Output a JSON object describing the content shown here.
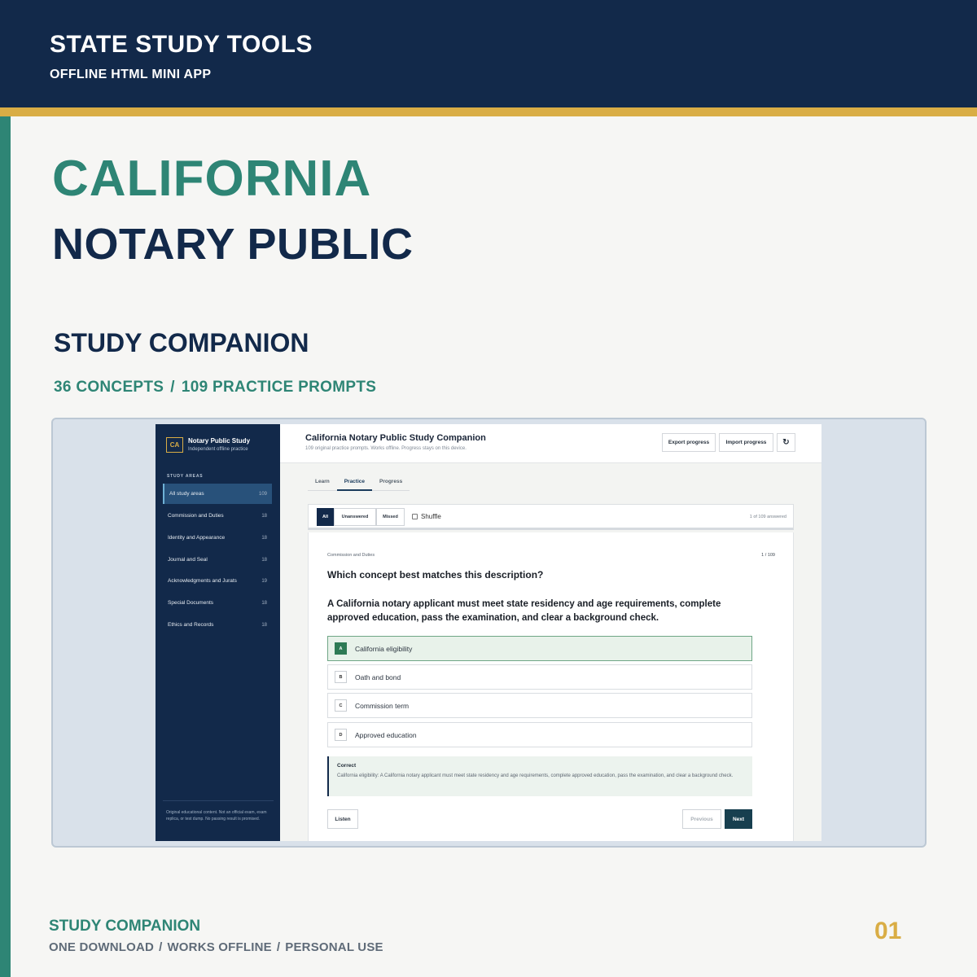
{
  "header": {
    "brand": "STATE STUDY TOOLS",
    "subtitle": "OFFLINE HTML MINI APP"
  },
  "hero": {
    "state": "CALIFORNIA",
    "exam": "NOTARY PUBLIC",
    "product": "STUDY COMPANION",
    "concepts": "36 CONCEPTS",
    "separator": "/",
    "prompts": "109 PRACTICE PROMPTS"
  },
  "app": {
    "sidebar": {
      "logo": "CA",
      "title": "Notary Public Study",
      "subtitle": "Independent offline practice",
      "section_label": "STUDY AREAS",
      "items": [
        {
          "label": "All study areas",
          "count": "109"
        },
        {
          "label": "Commission and Duties",
          "count": "18"
        },
        {
          "label": "Identity and Appearance",
          "count": "18"
        },
        {
          "label": "Journal and Seal",
          "count": "18"
        },
        {
          "label": "Acknowledgments and Jurats",
          "count": "19"
        },
        {
          "label": "Special Documents",
          "count": "18"
        },
        {
          "label": "Ethics and Records",
          "count": "18"
        }
      ],
      "footer": "Original educational content. Not an official exam, exam replica, or test dump. No passing result is promised."
    },
    "topbar": {
      "title": "California Notary Public Study Companion",
      "subtitle": "109 original practice prompts. Works offline. Progress stays on this device.",
      "export_label": "Export progress",
      "import_label": "Import progress",
      "reset_glyph": "↻"
    },
    "tabs": [
      {
        "label": "Learn"
      },
      {
        "label": "Practice"
      },
      {
        "label": "Progress"
      }
    ],
    "filters": {
      "all": "All",
      "unanswered": "Unanswered",
      "missed": "Missed",
      "shuffle": "Shuffle",
      "answered": "1 of 109 answered"
    },
    "question": {
      "area": "Commission and Duties",
      "number": "1 / 109",
      "prompt": "Which concept best matches this description?",
      "description": "A California notary applicant must meet state residency and age requirements, complete approved education, pass the examination, and clear a background check.",
      "options": [
        {
          "letter": "A",
          "text": "California eligibility"
        },
        {
          "letter": "B",
          "text": "Oath and bond"
        },
        {
          "letter": "C",
          "text": "Commission term"
        },
        {
          "letter": "D",
          "text": "Approved education"
        }
      ],
      "feedback_title": "Correct",
      "feedback_text": "California eligibility: A California notary applicant must meet state residency and age requirements, complete approved education, pass the examination, and clear a background check.",
      "listen_label": "Listen",
      "previous_label": "Previous",
      "next_label": "Next"
    }
  },
  "footer": {
    "product": "STUDY COMPANION",
    "tag1": "ONE DOWNLOAD",
    "tag2": "WORKS OFFLINE",
    "tag3": "PERSONAL USE",
    "separator": "/",
    "page": "01"
  },
  "colors": {
    "navy": "#12294a",
    "teal": "#2e8575",
    "gold": "#d9ad45"
  }
}
